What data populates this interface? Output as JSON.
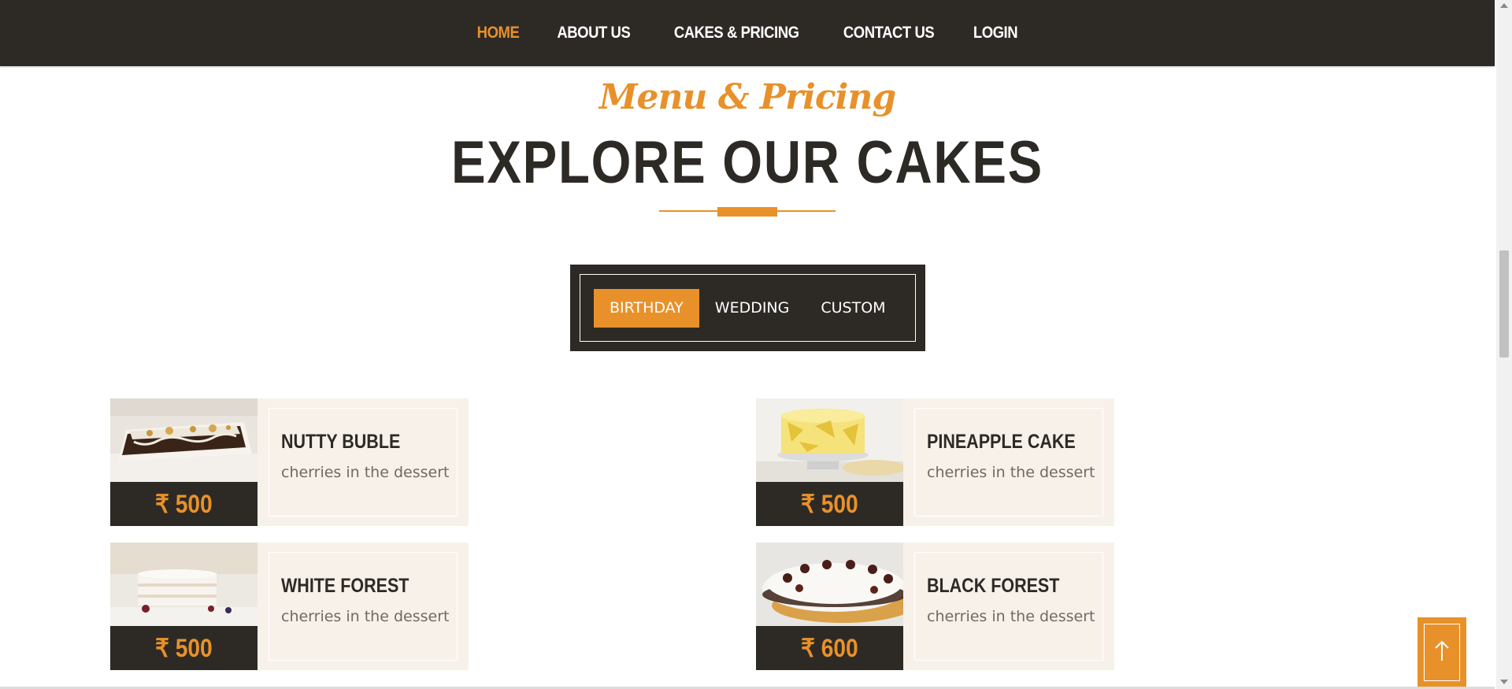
{
  "nav": {
    "items": [
      {
        "label": "HOME",
        "active": true
      },
      {
        "label": "ABOUT US",
        "active": false
      },
      {
        "label": "CAKES & PRICING",
        "active": false
      },
      {
        "label": "CONTACT US",
        "active": false
      },
      {
        "label": "LOGIN",
        "active": false
      }
    ]
  },
  "section": {
    "script_title": "Menu & Pricing",
    "title": "EXPLORE OUR CAKES"
  },
  "tabs": [
    {
      "label": "BIRTHDAY",
      "active": true
    },
    {
      "label": "WEDDING",
      "active": false
    },
    {
      "label": "CUSTOM",
      "active": false
    }
  ],
  "cakes": [
    {
      "name": "NUTTY BUBLE",
      "description": "cherries in the dessert",
      "price": "₹ 500",
      "image": "chocolate-cake-slice-photo"
    },
    {
      "name": "PINEAPPLE CAKE",
      "description": "cherries in the dessert",
      "price": "₹ 500",
      "image": "pineapple-cake-photo"
    },
    {
      "name": "WHITE FOREST",
      "description": "cherries in the dessert",
      "price": "₹ 500",
      "image": "white-forest-cake-photo"
    },
    {
      "name": "BLACK FOREST",
      "description": "cherries in the dessert",
      "price": "₹ 600",
      "image": "black-forest-cake-photo"
    }
  ],
  "colors": {
    "accent": "#e8912a",
    "dark": "#2d2a26",
    "card_bg": "#f8f1ea",
    "desc_text": "#6f6a65"
  },
  "icons": {
    "back_to_top": "arrow-up-icon"
  }
}
